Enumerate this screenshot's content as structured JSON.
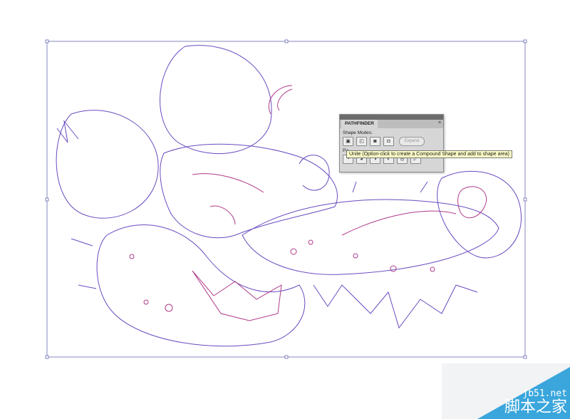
{
  "pathfinder": {
    "tab": "PATHFINDER",
    "shape_modes_label": "Shape Modes:",
    "pathfinders_label": "Pa",
    "expand_label": "Expand",
    "shape_mode_icons": [
      "unite-icon",
      "minus-front-icon",
      "intersect-icon",
      "exclude-icon"
    ],
    "pathfinder_icons": [
      "divide-icon",
      "trim-icon",
      "merge-icon",
      "crop-icon",
      "outline-icon",
      "minus-back-icon"
    ]
  },
  "tooltip": "Unite (Option-click to create a Compound Shape and add to shape area)",
  "watermark": {
    "line1": "jb51.net",
    "line2": "脚本之家"
  },
  "colors": {
    "path": "#5a4fc8",
    "stroke_alt": "#b03a8a",
    "accent": "#3aa6dc"
  }
}
